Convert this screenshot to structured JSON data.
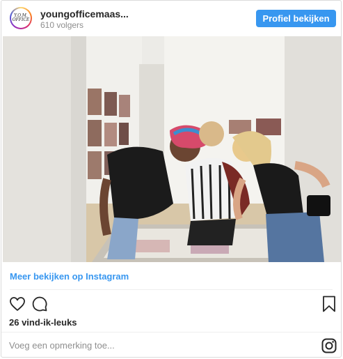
{
  "header": {
    "username": "youngofficemaas...",
    "followers": "610 volgers",
    "profile_button": "Profiel bekijken",
    "avatar_icon": "young-office-logo"
  },
  "photo": {
    "description_icon": "post-photo"
  },
  "footer": {
    "more_link": "Meer bekijken op Instagram",
    "likes": "26 vind-ik-leuks",
    "comment_placeholder": "Voeg een opmerking toe...",
    "icons": [
      "heart-icon",
      "comment-icon",
      "bookmark-icon",
      "instagram-icon"
    ]
  },
  "colors": {
    "accent": "#3897f0",
    "text": "#262626",
    "muted": "#8e8e8e"
  }
}
